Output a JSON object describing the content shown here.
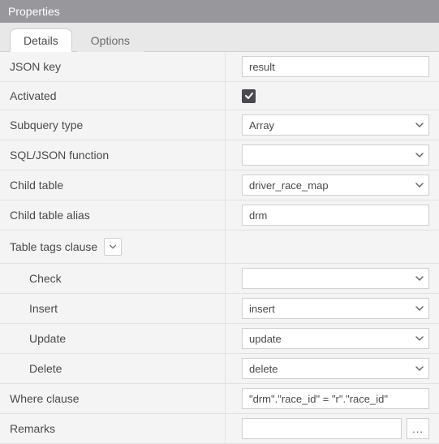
{
  "panel": {
    "title": "Properties"
  },
  "tabs": [
    {
      "label": "Details",
      "active": true
    },
    {
      "label": "Options",
      "active": false
    }
  ],
  "fields": {
    "json_key": {
      "label": "JSON key",
      "value": "result"
    },
    "activated": {
      "label": "Activated",
      "checked": true
    },
    "subquery_type": {
      "label": "Subquery type",
      "value": "Array"
    },
    "sql_json_function": {
      "label": "SQL/JSON function",
      "value": ""
    },
    "child_table": {
      "label": "Child table",
      "value": "driver_race_map"
    },
    "child_table_alias": {
      "label": "Child table alias",
      "value": "drm"
    },
    "table_tags_clause": {
      "label": "Table tags clause"
    },
    "check": {
      "label": "Check",
      "value": ""
    },
    "insert": {
      "label": "Insert",
      "value": "insert"
    },
    "update": {
      "label": "Update",
      "value": "update"
    },
    "delete": {
      "label": "Delete",
      "value": "delete"
    },
    "where_clause": {
      "label": "Where clause",
      "value": "\"drm\".\"race_id\" = \"r\".\"race_id\""
    },
    "remarks": {
      "label": "Remarks",
      "value": "",
      "more": "..."
    }
  }
}
